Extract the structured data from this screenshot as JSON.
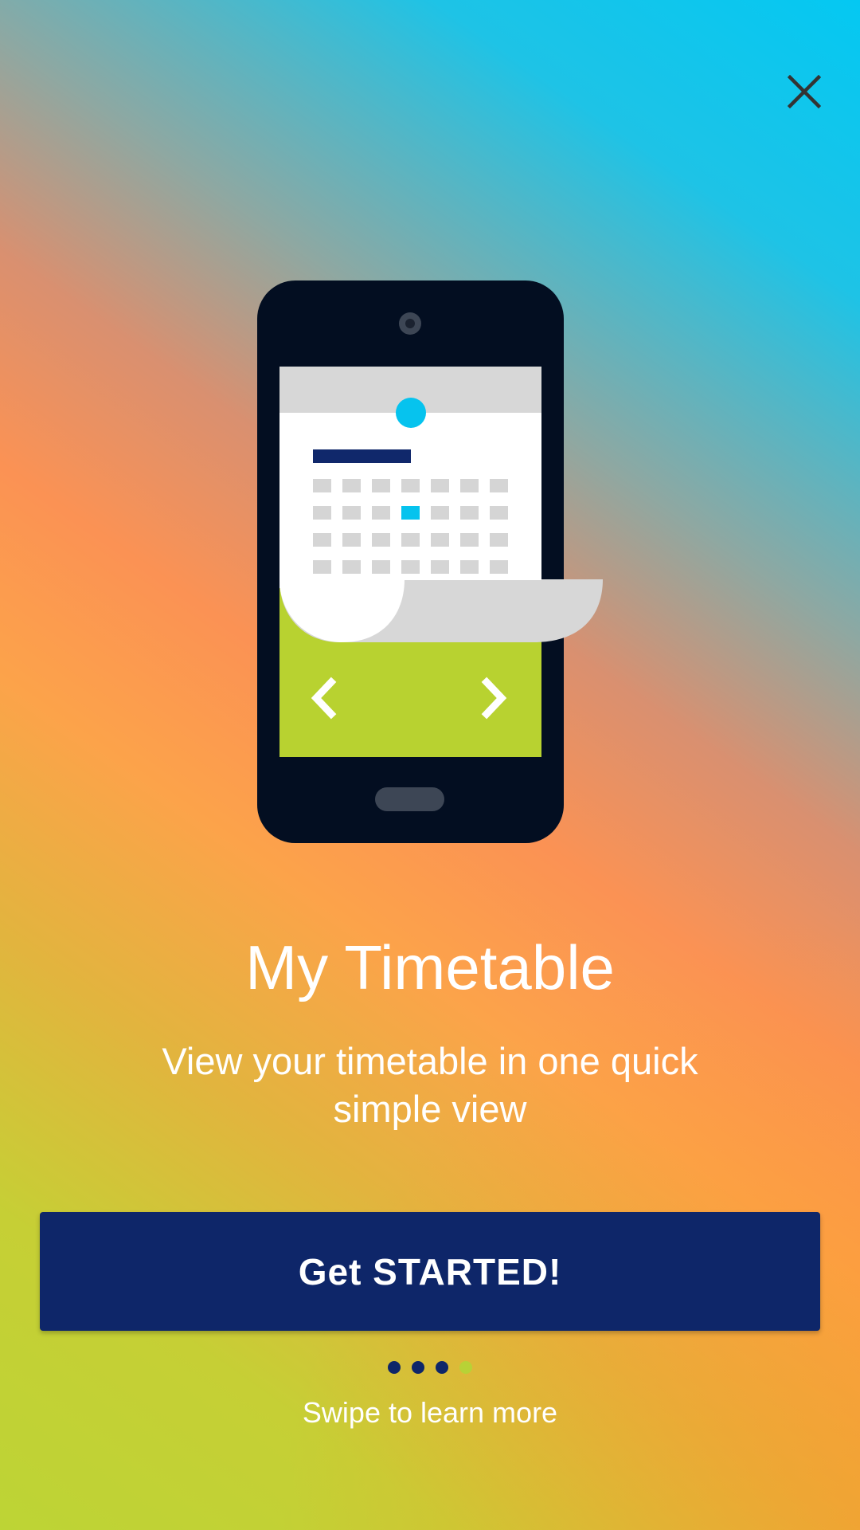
{
  "close_button": {
    "icon": "close-icon",
    "color": "#333333"
  },
  "illustration": {
    "icon": "phone-calendar-illustration",
    "colors": {
      "phone_body": "#030e21",
      "screen_green": "#b8d230",
      "calendar_header": "#d7d7d7",
      "calendar_accent": "#06c3ee",
      "calendar_bar": "#10286b",
      "calendar_cell": "#d5d5d5"
    }
  },
  "onboarding": {
    "title": "My Timetable",
    "description": "View your timetable in one quick simple view"
  },
  "cta": {
    "label": "Get STARTED!",
    "background": "#0e2669"
  },
  "pagination": {
    "total": 4,
    "active_index": 3,
    "active_color": "#b8d236",
    "inactive_color": "#0e2669"
  },
  "swipe_hint": "Swipe to learn more"
}
